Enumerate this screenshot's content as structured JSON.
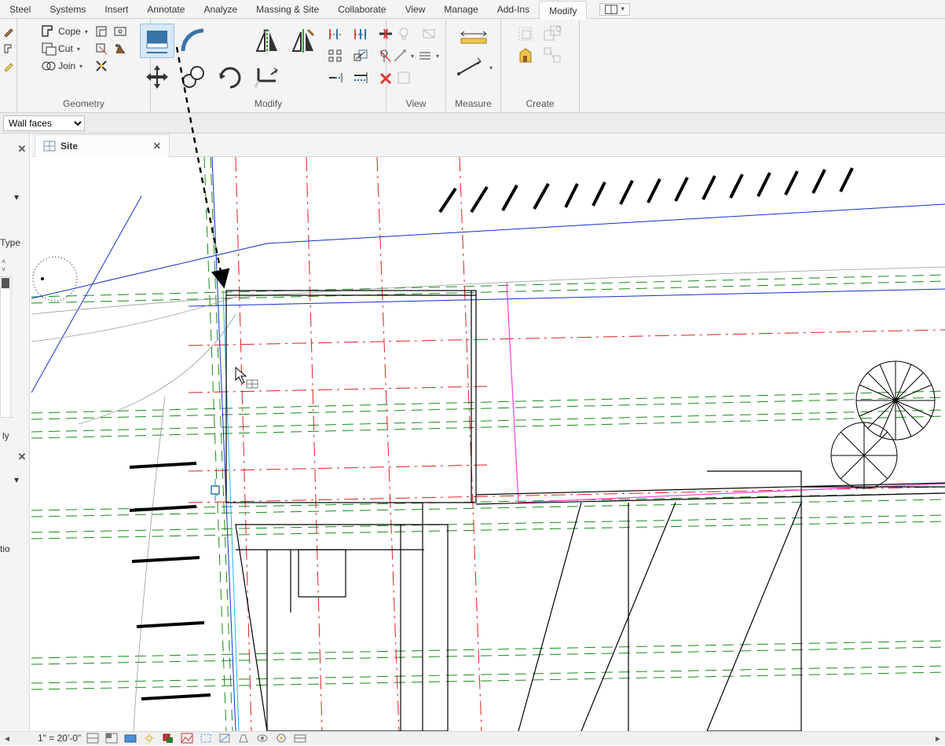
{
  "ribbon": {
    "tabs": [
      "Steel",
      "Systems",
      "Insert",
      "Annotate",
      "Analyze",
      "Massing & Site",
      "Collaborate",
      "View",
      "Manage",
      "Add-Ins",
      "Modify"
    ],
    "active_tab": "Modify",
    "panels": {
      "geometry": {
        "title": "Geometry",
        "cope": "Cope",
        "cut": "Cut",
        "join": "Join"
      },
      "modify": {
        "title": "Modify"
      },
      "view": {
        "title": "View"
      },
      "measure": {
        "title": "Measure"
      },
      "create": {
        "title": "Create"
      }
    }
  },
  "options_bar": {
    "combo_value": "Wall faces"
  },
  "properties": {
    "edit_type": "Type",
    "label_ly": "ly",
    "label_tio": "tio"
  },
  "view_tab": {
    "title": "Site"
  },
  "status": {
    "scale": "1\" = 20'-0\""
  },
  "icons": {
    "help": "?",
    "chevron_down": "▾",
    "close": "✕",
    "left": "◄",
    "right": "►",
    "chev_up": "˄",
    "chev_dn": "˅"
  }
}
